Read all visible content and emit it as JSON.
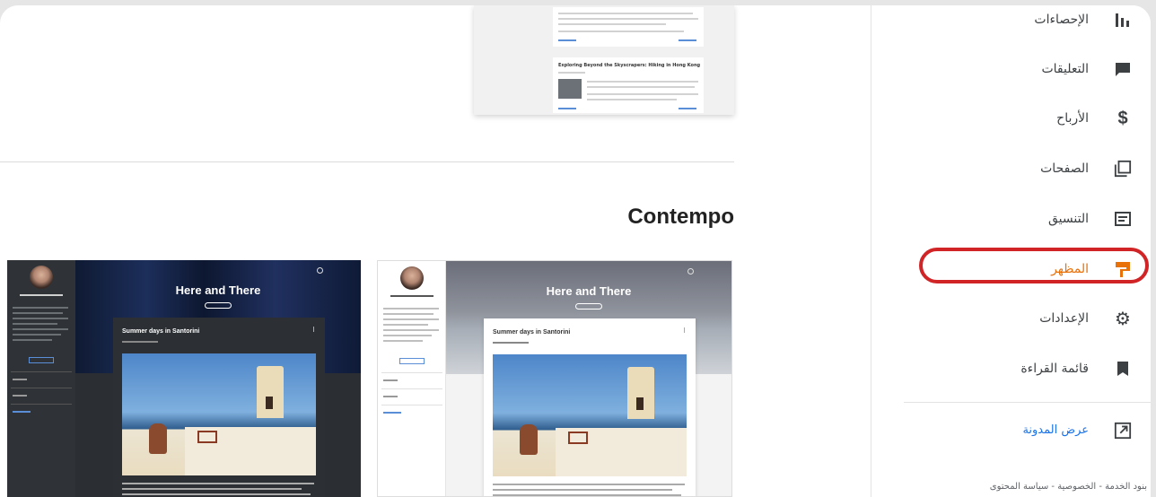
{
  "nav": {
    "items": [
      {
        "label": "الإحصاءات",
        "icon": "stats-icon",
        "active": false
      },
      {
        "label": "التعليقات",
        "icon": "comment-icon",
        "active": false
      },
      {
        "label": "الأرباح",
        "icon": "dollar-icon",
        "active": false
      },
      {
        "label": "الصفحات",
        "icon": "pages-icon",
        "active": false
      },
      {
        "label": "التنسيق",
        "icon": "layout-icon",
        "active": false
      },
      {
        "label": "المظهر",
        "icon": "paint-roller-icon",
        "active": true
      },
      {
        "label": "الإعدادات",
        "icon": "gear-icon",
        "active": false
      },
      {
        "label": "قائمة القراءة",
        "icon": "bookmark-icon",
        "active": false
      }
    ],
    "view_blog": {
      "label": "عرض المدونة",
      "icon": "external-link-icon"
    },
    "footer": "بنود الخدمة - الخصوصية - سياسة المحتوى"
  },
  "main": {
    "top_preview": {
      "post_title": "Exploring Beyond the Skyscrapers: Hiking in Hong Kong"
    },
    "section_title": "Contempo",
    "themes": [
      {
        "variant": "dark",
        "hero_title": "Here and There",
        "post_title": "Summer days in Santorini"
      },
      {
        "variant": "light",
        "hero_title": "Here and There",
        "post_title": "Summer days in Santorini"
      }
    ]
  },
  "colors": {
    "accent": "#e8710a",
    "highlight": "#d02427",
    "icon": "#3c4043",
    "link": "#1a73e8"
  }
}
